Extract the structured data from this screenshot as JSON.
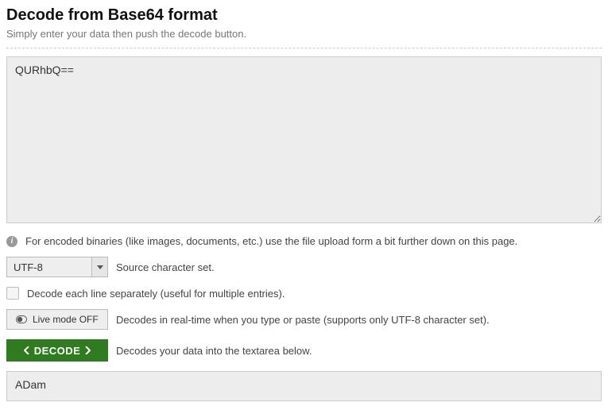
{
  "header": {
    "title": "Decode from Base64 format",
    "subtitle": "Simply enter your data then push the decode button."
  },
  "input": {
    "value": "QURhbQ=="
  },
  "hint": {
    "text": "For encoded binaries (like images, documents, etc.) use the file upload form a bit further down on this page."
  },
  "charset": {
    "selected": "UTF-8",
    "label": "Source character set."
  },
  "lineOption": {
    "label": "Decode each line separately (useful for multiple entries)."
  },
  "liveMode": {
    "buttonLabel": "Live mode OFF",
    "description": "Decodes in real-time when you type or paste (supports only UTF-8 character set)."
  },
  "decode": {
    "buttonLabel": "DECODE",
    "description": "Decodes your data into the textarea below."
  },
  "output": {
    "value": "ADam"
  }
}
